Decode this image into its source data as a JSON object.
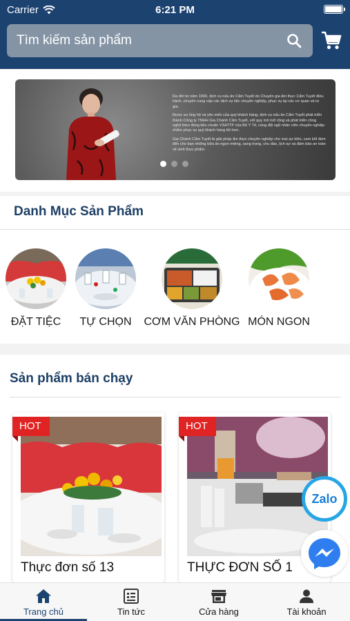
{
  "status_bar": {
    "carrier": "Carrier",
    "time": "6:21 PM"
  },
  "search": {
    "placeholder": "Tìm kiếm sản phẩm"
  },
  "banner": {
    "paragraphs": [
      "Ra đời từ năm 1990, dịch vụ nấu ăn Cẩm Tuyết do Chuyên gia ẩm thực Cẩm Tuyết điều hành, chuyên cung cấp các dịch vụ tiệc chuyên nghiệp, phục vụ tại các cơ quan và tư gia.",
      "Được sự ủng hộ và yêu mến của quý khách hàng, dịch vụ nấu ăn Cẩm Tuyết phát triển thành Công ty TNHH Gia Chánh Cẩm Tuyết, với quy mô mở rộng và phát triển công nghệ theo đúng tiêu chuẩn VSATTP của Bộ Y Tế, cùng đội ngũ nhân viên chuyên nghiệp nhằm phục vụ quý khách hàng tốt hơn.",
      "Gia Chánh Cẩm Tuyết là giải pháp ẩm thực chuyên nghiệp cho mọi sự kiện, cam kết đem đến cho bạn những bữa ăn ngon miệng, sang trọng, chu đáo, lịch sự và đảm bảo an toàn vệ sinh thực phẩm."
    ]
  },
  "categories": {
    "title": "Danh Mục Sản Phẩm",
    "items": [
      {
        "label": "ĐẶT TIỆC"
      },
      {
        "label": "TỰ CHỌN"
      },
      {
        "label": "CƠM VĂN PHÒNG"
      },
      {
        "label": "MÓN NGON"
      }
    ]
  },
  "bestsellers": {
    "title": "Sản phẩm bán chạy",
    "badge": "HOT",
    "products": [
      {
        "name": "Thực đơn số 13"
      },
      {
        "name": "THỰC ĐƠN SỐ 1"
      }
    ]
  },
  "floating": {
    "zalo": "Zalo"
  },
  "tabs": [
    {
      "label": "Trang chủ",
      "icon": "home-icon",
      "active": true
    },
    {
      "label": "Tin tức",
      "icon": "news-icon",
      "active": false
    },
    {
      "label": "Cửa hàng",
      "icon": "store-icon",
      "active": false
    },
    {
      "label": "Tài khoản",
      "icon": "account-icon",
      "active": false
    }
  ],
  "colors": {
    "header": "#1c4270",
    "badge": "#e02424",
    "title": "#1d3f66",
    "zalo": "#27a6e6"
  }
}
